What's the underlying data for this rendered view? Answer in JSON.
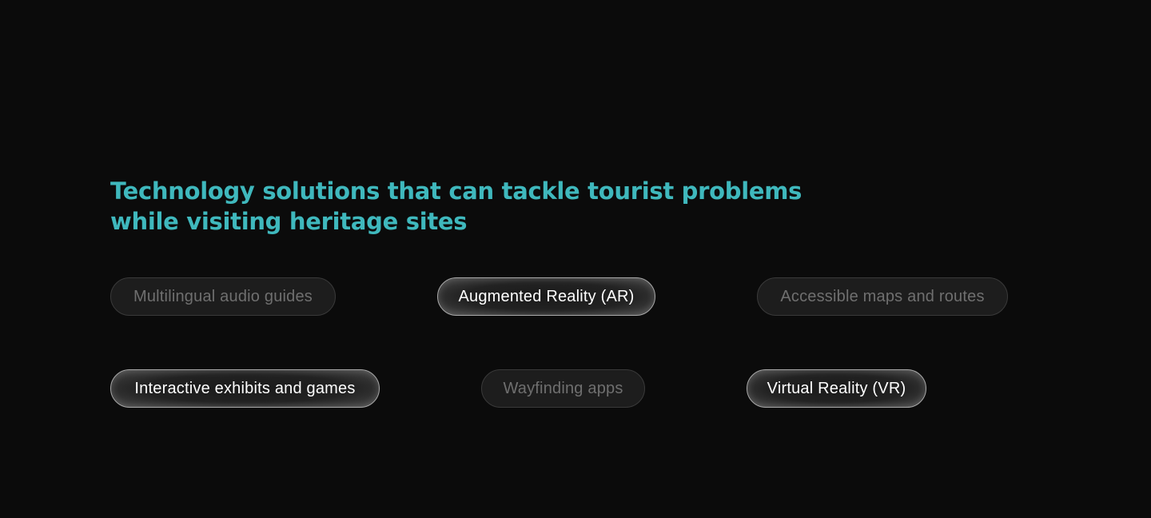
{
  "heading": {
    "line1": "Technology solutions that can tackle tourist problems",
    "line2": "while visiting heritage sites",
    "color": "#3fb8bd"
  },
  "solutions": [
    {
      "label": "Multilingual audio guides",
      "state": "inactive"
    },
    {
      "label": "Augmented Reality (AR)",
      "state": "active"
    },
    {
      "label": "Accessible maps and routes",
      "state": "inactive"
    },
    {
      "label": "Interactive exhibits and games",
      "state": "active"
    },
    {
      "label": "Wayfinding apps",
      "state": "inactive"
    },
    {
      "label": "Virtual Reality (VR)",
      "state": "active"
    }
  ],
  "colors": {
    "background": "#0b0b0b",
    "active_text": "#ffffff",
    "inactive_text": "#6f6f6f"
  }
}
